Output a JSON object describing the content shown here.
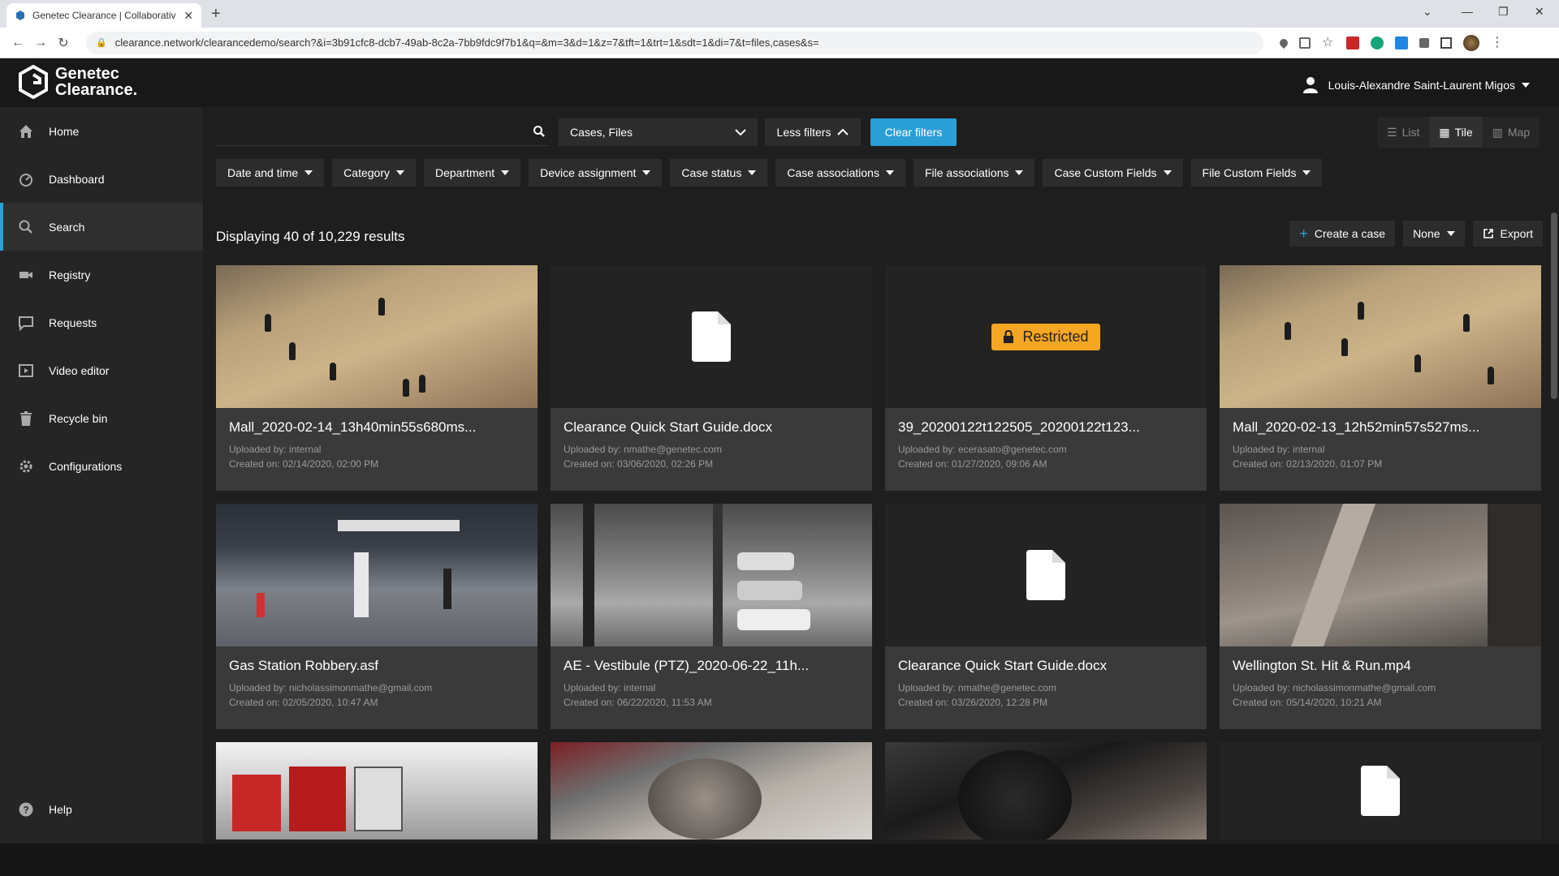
{
  "browser": {
    "tab_title": "Genetec Clearance | Collaborativ",
    "url": "clearance.network/clearancedemo/search?&i=3b91cfc8-dcb7-49ab-8c2a-7bb9fdc9f7b1&q=&m=3&d=1&z=7&tft=1&trt=1&sdt=1&di=7&t=files,cases&s="
  },
  "app": {
    "logo_line1": "Genetec",
    "logo_line2": "Clearance.",
    "user_name": "Louis-Alexandre Saint-Laurent Migos"
  },
  "sidebar": {
    "items": [
      {
        "label": "Home",
        "icon": "home-icon"
      },
      {
        "label": "Dashboard",
        "icon": "dashboard-icon"
      },
      {
        "label": "Search",
        "icon": "search-icon",
        "active": true
      },
      {
        "label": "Registry",
        "icon": "camera-icon"
      },
      {
        "label": "Requests",
        "icon": "message-icon"
      },
      {
        "label": "Video editor",
        "icon": "video-editor-icon"
      },
      {
        "label": "Recycle bin",
        "icon": "trash-icon"
      },
      {
        "label": "Configurations",
        "icon": "gear-icon"
      }
    ],
    "help_label": "Help"
  },
  "toolbar": {
    "search_value": "",
    "scope_select": "Cases, Files",
    "less_filters": "Less filters",
    "clear_filters": "Clear filters",
    "views": {
      "list": "List",
      "tile": "Tile",
      "map": "Map",
      "selected": "Tile"
    }
  },
  "filters": [
    "Date and time",
    "Category",
    "Department",
    "Device assignment",
    "Case status",
    "Case associations",
    "File associations",
    "Case Custom Fields",
    "File Custom Fields"
  ],
  "results": {
    "summary": "Displaying 40 of 10,229 results",
    "create_case": "Create a case",
    "group_select": "None",
    "export": "Export"
  },
  "cards": [
    {
      "name": "Mall_2020-02-14_13h40min55s680ms...",
      "uploaded": "Uploaded by:  internal",
      "created": "Created on:  02/14/2020, 02:00 PM",
      "thumb": "mall"
    },
    {
      "name": "Clearance Quick Start Guide.docx",
      "uploaded": "Uploaded by:  nmathe@genetec.com",
      "created": "Created on:  03/06/2020, 02:26 PM",
      "thumb": "doc"
    },
    {
      "name": "39_20200122t122505_20200122t123...",
      "uploaded": "Uploaded by:  ecerasato@genetec.com",
      "created": "Created on:  01/27/2020, 09:06 AM",
      "thumb": "restricted",
      "badge": "Restricted"
    },
    {
      "name": "Mall_2020-02-13_12h52min57s527ms...",
      "uploaded": "Uploaded by:  internal",
      "created": "Created on:  02/13/2020, 01:07 PM",
      "thumb": "mall"
    },
    {
      "name": "Gas Station Robbery.asf",
      "uploaded": "Uploaded by:  nicholassimonmathe@gmail.com",
      "created": "Created on:  02/05/2020, 10:47 AM",
      "thumb": "gas"
    },
    {
      "name": "AE - Vestibule (PTZ)_2020-06-22_11h...",
      "uploaded": "Uploaded by:  internal",
      "created": "Created on:  06/22/2020, 11:53 AM",
      "thumb": "lot"
    },
    {
      "name": "Clearance Quick Start Guide.docx",
      "uploaded": "Uploaded by:  nmathe@genetec.com",
      "created": "Created on:  03/26/2020, 12:28 PM",
      "thumb": "doc"
    },
    {
      "name": "Wellington St. Hit & Run.mp4",
      "uploaded": "Uploaded by:  nicholassimonmathe@gmail.com",
      "created": "Created on:  05/14/2020, 10:21 AM",
      "thumb": "street"
    },
    {
      "thumb": "dock"
    },
    {
      "thumb": "dog"
    },
    {
      "thumb": "dark"
    },
    {
      "thumb": "doc"
    }
  ],
  "colors": {
    "accent": "#2a9fd6",
    "restricted": "#f5a623",
    "sidebar_bg": "#252525",
    "main_bg": "#1e1e1e"
  }
}
